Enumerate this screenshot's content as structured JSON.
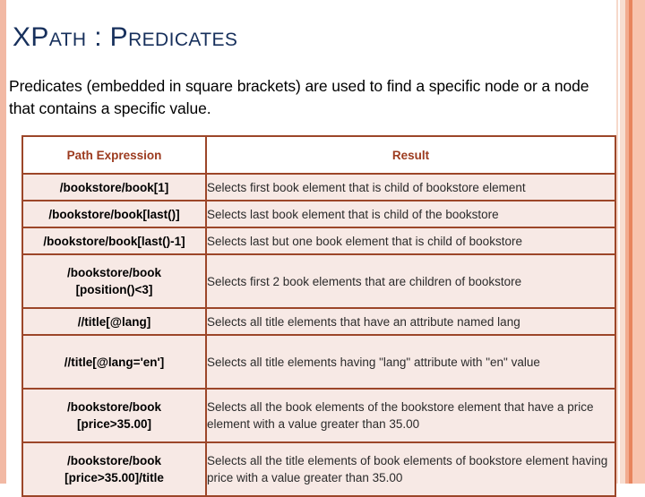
{
  "slide": {
    "title": "XPath : Predicates",
    "subtitle": "Predicates (embedded in square brackets) are used to find a specific node or a node that contains a specific value."
  },
  "colors": {
    "title_text": "#17305c",
    "body_text": "#000000",
    "table_border": "#9c4629",
    "table_header_text": "#9c3b1f",
    "row_background": "#f7e9e5",
    "header_background": "#ffffff",
    "left_bar": "#f2b9a4",
    "right_stripe_dark": "#e8845d",
    "right_stripe_light": "#f8c3ae"
  },
  "table": {
    "headers": {
      "path": "Path Expression",
      "result": "Result"
    },
    "rows": [
      {
        "path": "/bookstore/book[1]",
        "result": "Selects first book element that is child of bookstore element",
        "size": "short"
      },
      {
        "path": "/bookstore/book[last()]",
        "result": "Selects last book element that is child of the bookstore",
        "size": "short"
      },
      {
        "path": "/bookstore/book[last()-1]",
        "result": "Selects last but one book element that is child of bookstore",
        "size": "short"
      },
      {
        "path": "/bookstore/book\n[position()<3]",
        "result": "Selects first 2 book elements that are children of bookstore",
        "size": "tall"
      },
      {
        "path": "//title[@lang]",
        "result": "Selects all title elements that have an attribute named lang",
        "size": "short"
      },
      {
        "path": "//title[@lang='en']",
        "result": "Selects all title elements having \"lang\" attribute with \"en\" value",
        "size": "tall"
      },
      {
        "path": "/bookstore/book\n[price>35.00]",
        "result": "Selects all the book elements of the bookstore element that have a price element with a value greater than 35.00",
        "size": "tall"
      },
      {
        "path": "/bookstore/book\n[price>35.00]/title",
        "result": "Selects all the title elements of book elements of bookstore element having price with a value greater than 35.00",
        "size": "tall"
      }
    ]
  }
}
